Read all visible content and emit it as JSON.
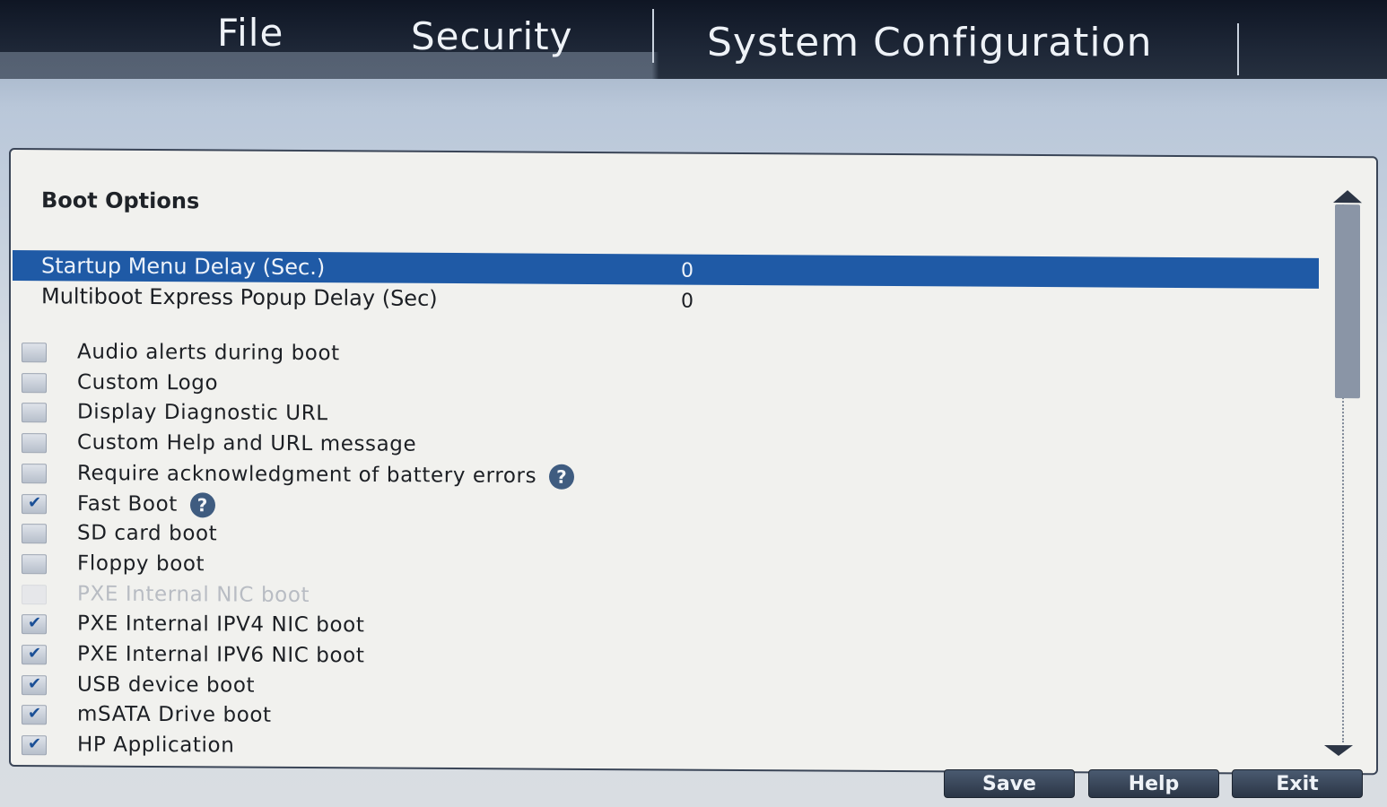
{
  "menu": {
    "file": "File",
    "security": "Security",
    "system_configuration": "System Configuration"
  },
  "panel": {
    "section_title": "Boot Options",
    "settings": [
      {
        "label": "Startup Menu Delay (Sec.)",
        "value": "0",
        "selected": true
      },
      {
        "label": "Multiboot Express Popup Delay (Sec)",
        "value": "0",
        "selected": false
      }
    ],
    "options": [
      {
        "label": "Audio alerts during boot",
        "checked": false,
        "disabled": false,
        "help": false
      },
      {
        "label": "Custom Logo",
        "checked": false,
        "disabled": false,
        "help": false
      },
      {
        "label": "Display Diagnostic URL",
        "checked": false,
        "disabled": false,
        "help": false
      },
      {
        "label": "Custom Help and URL message",
        "checked": false,
        "disabled": false,
        "help": false
      },
      {
        "label": "Require acknowledgment of battery errors",
        "checked": false,
        "disabled": false,
        "help": true
      },
      {
        "label": "Fast Boot",
        "checked": true,
        "disabled": false,
        "help": true
      },
      {
        "label": "SD card boot",
        "checked": false,
        "disabled": false,
        "help": false
      },
      {
        "label": "Floppy boot",
        "checked": false,
        "disabled": false,
        "help": false
      },
      {
        "label": "PXE Internal NIC boot",
        "checked": false,
        "disabled": true,
        "help": false
      },
      {
        "label": "PXE Internal IPV4 NIC boot",
        "checked": true,
        "disabled": false,
        "help": false
      },
      {
        "label": "PXE Internal IPV6 NIC boot",
        "checked": true,
        "disabled": false,
        "help": false
      },
      {
        "label": "USB device boot",
        "checked": true,
        "disabled": false,
        "help": false
      },
      {
        "label": "mSATA Drive boot",
        "checked": true,
        "disabled": false,
        "help": false
      },
      {
        "label": "HP Application",
        "checked": true,
        "disabled": false,
        "help": false
      }
    ]
  },
  "buttons": {
    "save": "Save",
    "help": "Help",
    "exit": "Exit"
  },
  "colors": {
    "selection": "#1f5aa6",
    "menubar": "#1d2636",
    "panel_bg": "#f1f1ee"
  },
  "help_icon_glyph": "?"
}
